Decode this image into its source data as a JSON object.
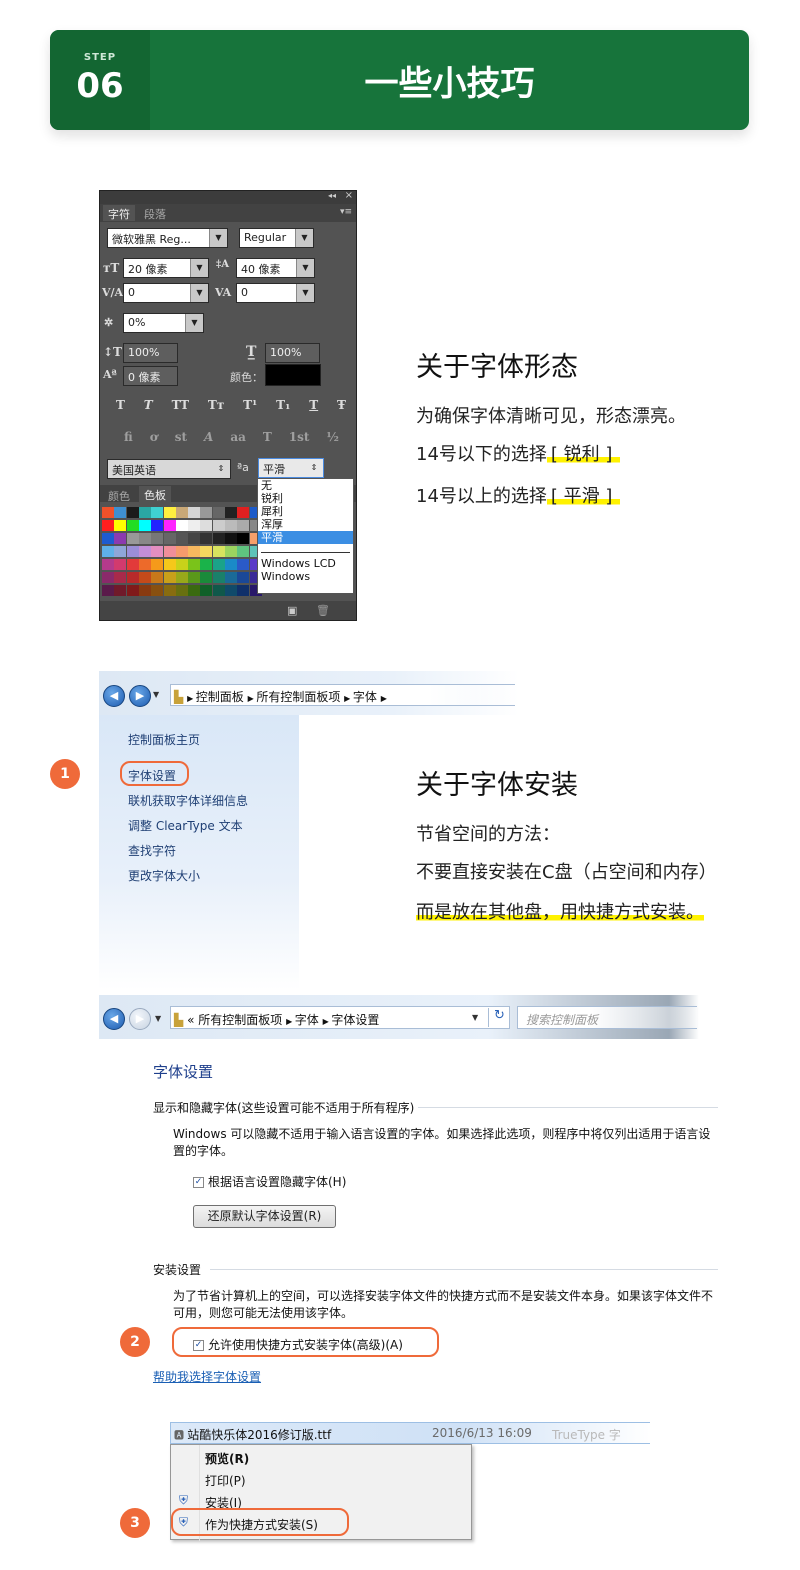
{
  "header": {
    "step_label": "STEP",
    "step_number": "06",
    "title": "一些小技巧"
  },
  "ps_panel": {
    "tabs": [
      "字符",
      "段落"
    ],
    "font_family": "微软雅黑 Reg...",
    "font_style": "Regular",
    "font_size": "20 像素",
    "leading": "40 像素",
    "kerning": "0",
    "tracking": "0",
    "scale_pct": "0%",
    "v_scale": "100%",
    "h_scale": "100%",
    "baseline": "0 像素",
    "color_label": "颜色：",
    "style_row1": [
      "T",
      "T",
      "TT",
      "Tт",
      "T¹",
      "T₁",
      "T",
      "Ŧ"
    ],
    "style_row2": [
      "fi",
      "ơ",
      "st",
      "A",
      "aa",
      "T",
      "1st",
      "½"
    ],
    "language": "美国英语",
    "aa_label": "ªa",
    "antialias": "平滑",
    "antialias_options": [
      "无",
      "锐利",
      "犀利",
      "浑厚",
      "平滑"
    ],
    "antialias_options2": [
      "Windows LCD",
      "Windows"
    ],
    "swatch_tabs": [
      "颜色",
      "色板"
    ]
  },
  "section1": {
    "title": "关于字体形态",
    "line1": "为确保字体清晰可见，形态漂亮。",
    "line2_a": "14号以下的选择",
    "line2_b": "[ 锐利 ]",
    "line3_a": "14号以上的选择",
    "line3_b": "[ 平滑 ]"
  },
  "explorer1": {
    "crumbs": [
      "控制面板",
      "所有控制面板项",
      "字体"
    ],
    "sidebar": [
      "控制面板主页",
      "字体设置",
      "联机获取字体详细信息",
      "调整 ClearType 文本",
      "查找字符",
      "更改字体大小"
    ]
  },
  "section2": {
    "title": "关于字体安装",
    "line1": "节省空间的方法：",
    "line2": "不要直接安装在C盘（占空间和内存）",
    "line3": "而是放在其他盘，用快捷方式安装。"
  },
  "explorer2": {
    "chev": "«",
    "crumbs": [
      "所有控制面板项",
      "字体",
      "字体设置"
    ],
    "search_placeholder": "搜索控制面板",
    "page_title": "字体设置",
    "group1": "显示和隐藏字体(这些设置可能不适用于所有程序)",
    "group1_desc1": "Windows 可以隐藏不适用于输入语言设置的字体。如果选择此选项，则程序中将仅列出适用于语言设",
    "group1_desc2": "置的字体。",
    "group1_checkbox": "根据语言设置隐藏字体(H)",
    "restore_button": "还原默认字体设置(R)",
    "group2": "安装设置",
    "group2_desc1": "为了节省计算机上的空间，可以选择安装字体文件的快捷方式而不是安装文件本身。如果该字体文件不",
    "group2_desc2": "可用，则您可能无法使用该字体。",
    "group2_checkbox": "允许使用快捷方式安装字体(高级)(A)",
    "help_link": "帮助我选择字体设置"
  },
  "context": {
    "file_name": "站酷快乐体2016修订版.ttf",
    "file_date": "2016/6/13 16:09",
    "file_type": "TrueType 字",
    "items": [
      "预览(R)",
      "打印(P)",
      "安装(I)",
      "作为快捷方式安装(S)"
    ]
  },
  "badges": [
    "1",
    "2",
    "3"
  ]
}
